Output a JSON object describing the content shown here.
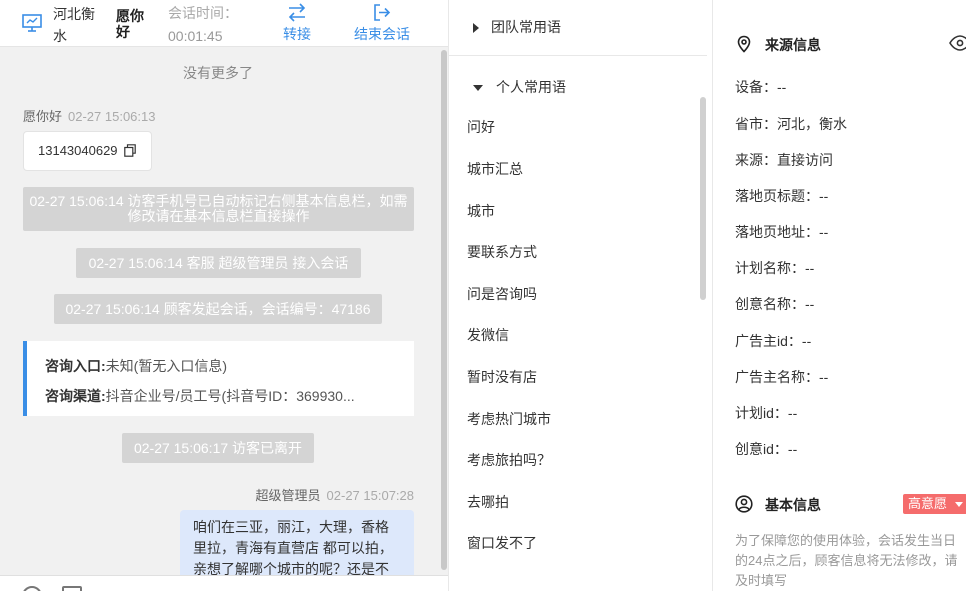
{
  "chat_header": {
    "location": "河北衡水",
    "visitor_name": "愿你好",
    "session_time_label": "会话时间：",
    "session_time": "00:01:45",
    "transfer_label": "转接",
    "end_label": "结束会话"
  },
  "chat": {
    "no_more": "没有更多了",
    "visitor_msg": {
      "sender": "愿你好",
      "time": "02-27 15:06:13",
      "phone": "13143040629"
    },
    "system_msgs": [
      "02-27 15:06:14 访客手机号已自动标记右侧基本信息栏，如需修改请在基本信息栏直接操作",
      "02-27 15:06:14 客服 超级管理员 接入会话",
      "02-27 15:06:14 顾客发起会话，会话编号：47186",
      "02-27 15:06:17 访客已离开"
    ],
    "consult": {
      "entry_label": "咨询入口:",
      "entry_value": "未知(暂无入口信息)",
      "channel_label": "咨询渠道:",
      "channel_value": "抖音企业号/员工号(抖音号ID：369930..."
    },
    "agent_msg": {
      "sender": "超级管理员",
      "time": "02-27 15:07:28",
      "text": "咱们在三亚，丽江，大理，香格里拉，青海有直营店 都可以拍，亲想了解哪个城市的呢？还是不"
    }
  },
  "phrases": {
    "team_group": "团队常用语",
    "personal_group": "个人常用语",
    "items": [
      "问好",
      "城市汇总",
      "城市",
      "要联系方式",
      "问是咨询吗",
      "发微信",
      "暂时没有店",
      "考虑热门城市",
      "考虑旅拍吗？",
      "去哪拍",
      "窗口发不了"
    ]
  },
  "info": {
    "source_title": "来源信息",
    "fields": [
      {
        "label": "设备：",
        "value": "--"
      },
      {
        "label": "省市：",
        "value": "河北，衡水"
      },
      {
        "label": "来源：",
        "value": "直接访问"
      },
      {
        "label": "落地页标题：",
        "value": "--"
      },
      {
        "label": "落地页地址：",
        "value": "--"
      },
      {
        "label": "计划名称：",
        "value": "--"
      },
      {
        "label": "创意名称：",
        "value": "--"
      },
      {
        "label": "广告主id：",
        "value": "--"
      },
      {
        "label": "广告主名称：",
        "value": "--"
      },
      {
        "label": "计划id：",
        "value": "--"
      },
      {
        "label": "创意id：",
        "value": "--"
      }
    ],
    "basic_title": "基本信息",
    "intent_badge": "高意愿",
    "notice": "为了保障您的使用体验，会话发生当日的24点之后，顾客信息将无法修改，请及时填写"
  },
  "colors": {
    "accent": "#3a8ee6",
    "badge": "#f56c6c",
    "system_msg_bg": "#d4d4d4",
    "agent_bubble": "#dde8fb"
  }
}
